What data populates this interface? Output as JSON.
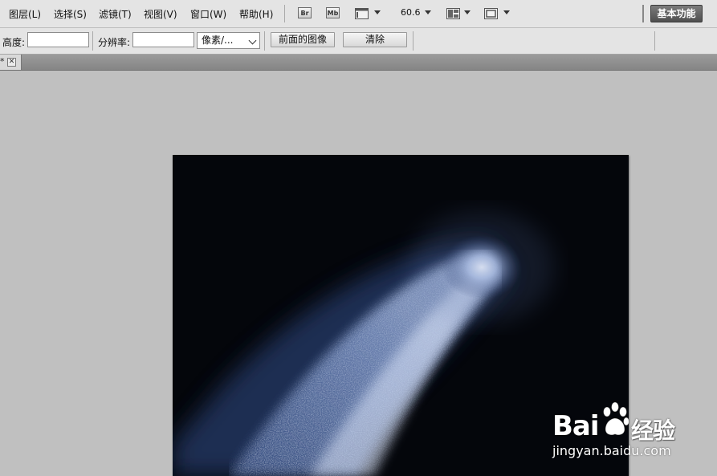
{
  "menubar": {
    "items": [
      "图层(L)",
      "选择(S)",
      "滤镜(T)",
      "视图(V)",
      "窗口(W)",
      "帮助(H)"
    ],
    "bridge_icon": "Br",
    "minibridge_icon": "Mb",
    "zoom_value": "60.6",
    "workspace_button": "基本功能"
  },
  "options": {
    "height_label": "高度:",
    "resolution_label": "分辨率:",
    "unit_select": "像素/...",
    "front_image_button": "前面的图像",
    "clear_button": "清除"
  },
  "document": {
    "tab_marker": "*",
    "close_glyph": "✕"
  },
  "watermark": {
    "logo_text": "Bai",
    "logo_suffix": "经验",
    "url": "jingyan.baidu.com"
  },
  "colors": {
    "accent_blue": "#6f8fc4",
    "canvas_bg": "#05070c"
  }
}
